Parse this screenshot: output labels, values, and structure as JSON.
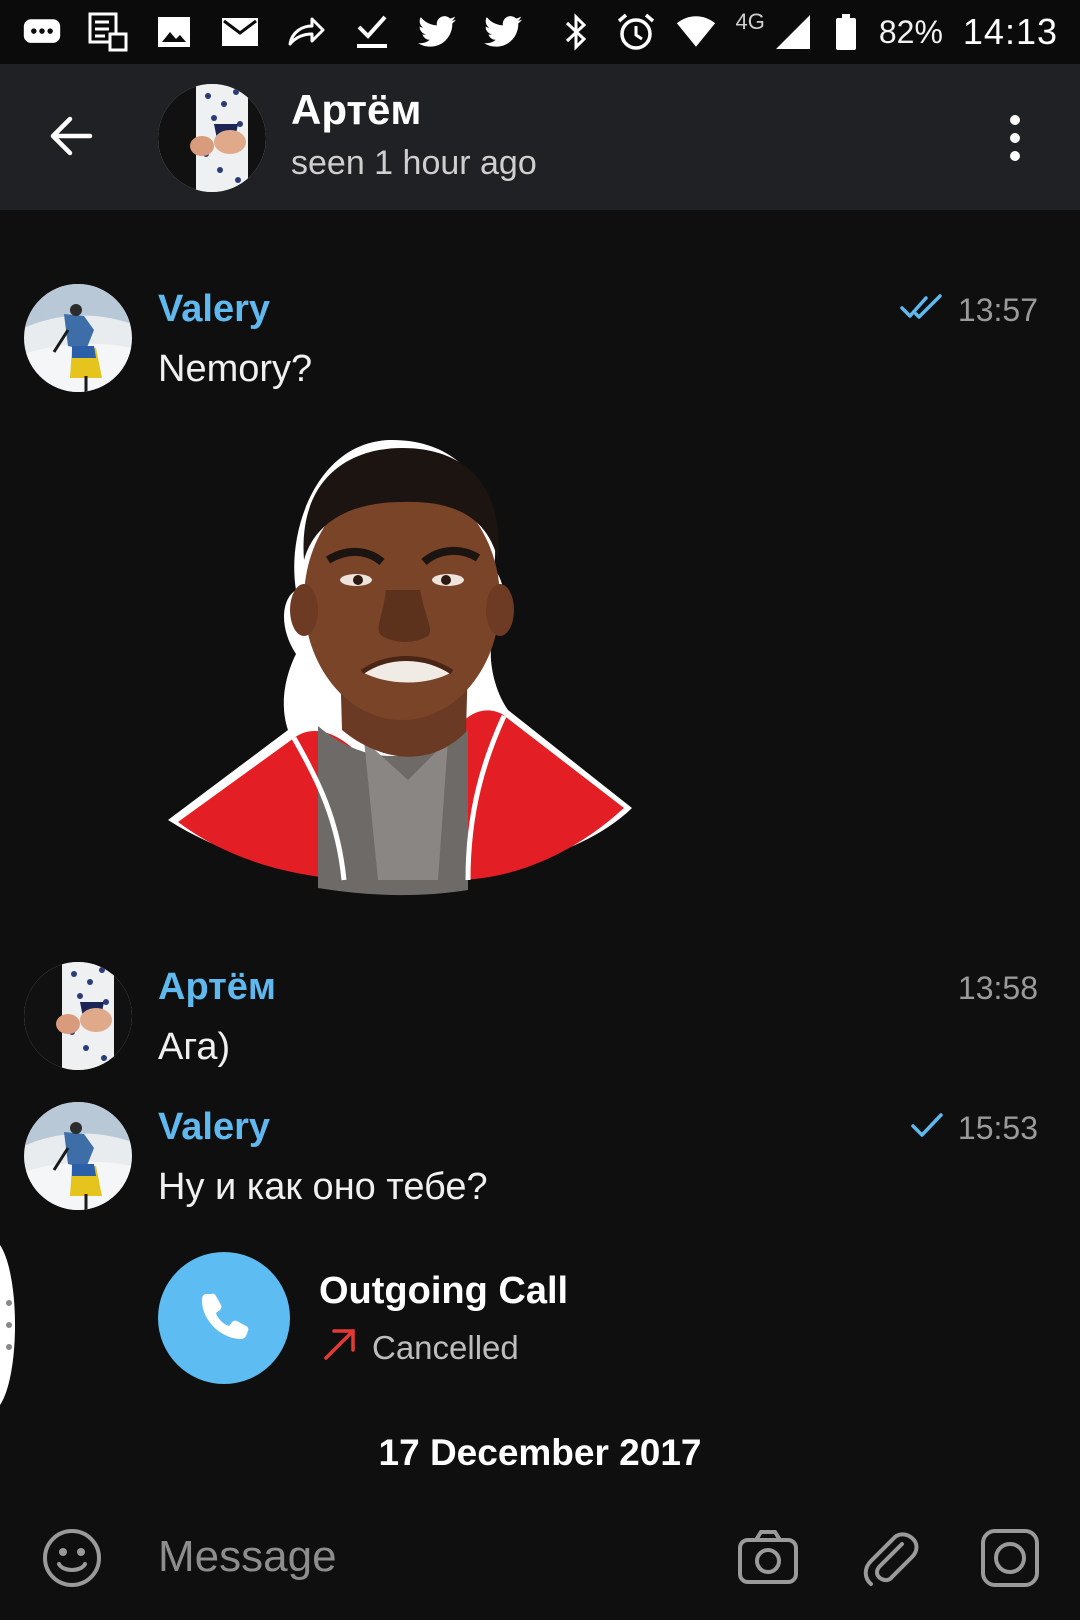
{
  "status_bar": {
    "battery": "82%",
    "time": "14:13",
    "network": "4G",
    "icons": [
      "chat-bubble-icon",
      "checklist-icon",
      "image-icon",
      "mail-icon",
      "share-arrow-icon",
      "download-check-icon",
      "twitter-icon",
      "twitter-icon",
      "bluetooth-icon",
      "alarm-icon",
      "wifi-icon",
      "signal-icon",
      "battery-icon"
    ]
  },
  "header": {
    "name": "Артём",
    "status": "seen 1 hour ago",
    "back_icon": "arrow-left-icon",
    "menu_icon": "more-vertical-icon"
  },
  "messages": [
    {
      "sender": "Valery",
      "text": "Nemory?",
      "time": "13:57",
      "status": "read"
    },
    {
      "sender": "Артём",
      "text": "Ага)",
      "time": "13:58",
      "status": ""
    },
    {
      "sender": "Valery",
      "text": "Ну и как оно тебе?",
      "time": "15:53",
      "status": "sent"
    }
  ],
  "call": {
    "title": "Outgoing Call",
    "status": "Cancelled",
    "icon": "phone-icon",
    "arrow_icon": "outgoing-arrow-icon"
  },
  "date_separator": "17 December 2017",
  "input": {
    "placeholder": "Message",
    "emoji_icon": "smiley-icon",
    "camera_icon": "camera-icon",
    "attach_icon": "paperclip-icon",
    "video_icon": "video-message-icon"
  },
  "colors": {
    "accent": "#5fb8ee",
    "call_button": "#5dbcf1",
    "cancelled_arrow": "#e53935",
    "header_bg": "#202124",
    "chat_bg": "#0f0f10"
  }
}
